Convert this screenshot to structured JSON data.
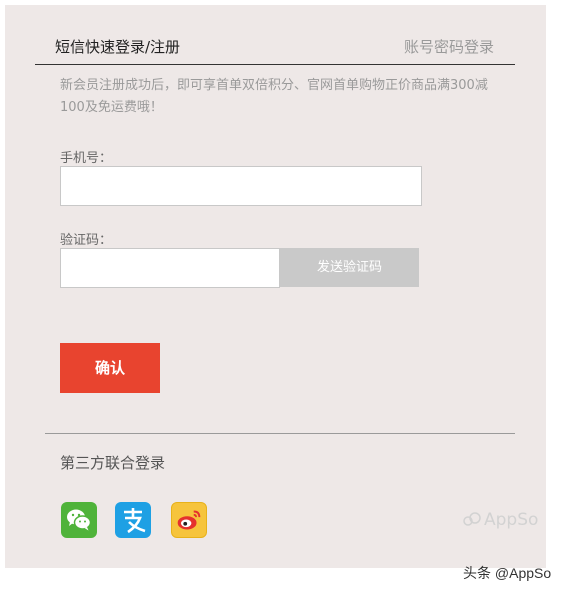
{
  "tabs": {
    "sms_login": "短信快速登录/注册",
    "password_login": "账号密码登录"
  },
  "notice": "新会员注册成功后，即可享首单双倍积分、官网首单购物正价商品满300减100及免运费哦！",
  "phone": {
    "label": "手机号：",
    "value": "",
    "placeholder": ""
  },
  "code": {
    "label": "验证码：",
    "value": "",
    "placeholder": "",
    "send_button": "发送验证码"
  },
  "confirm_button": "确认",
  "third_party": {
    "title": "第三方联合登录",
    "providers": [
      {
        "name": "wechat",
        "icon": "wechat-icon",
        "color": "#4fb33a"
      },
      {
        "name": "alipay",
        "icon": "alipay-icon",
        "color": "#1ea0e4"
      },
      {
        "name": "weibo",
        "icon": "weibo-icon",
        "color": "#f6c43c"
      }
    ]
  },
  "watermark": "AppSo",
  "footer": "头条 @AppSo",
  "colors": {
    "panel_bg": "#eee8e7",
    "confirm": "#e8442f",
    "send_code_bg": "#c9c9c9"
  }
}
